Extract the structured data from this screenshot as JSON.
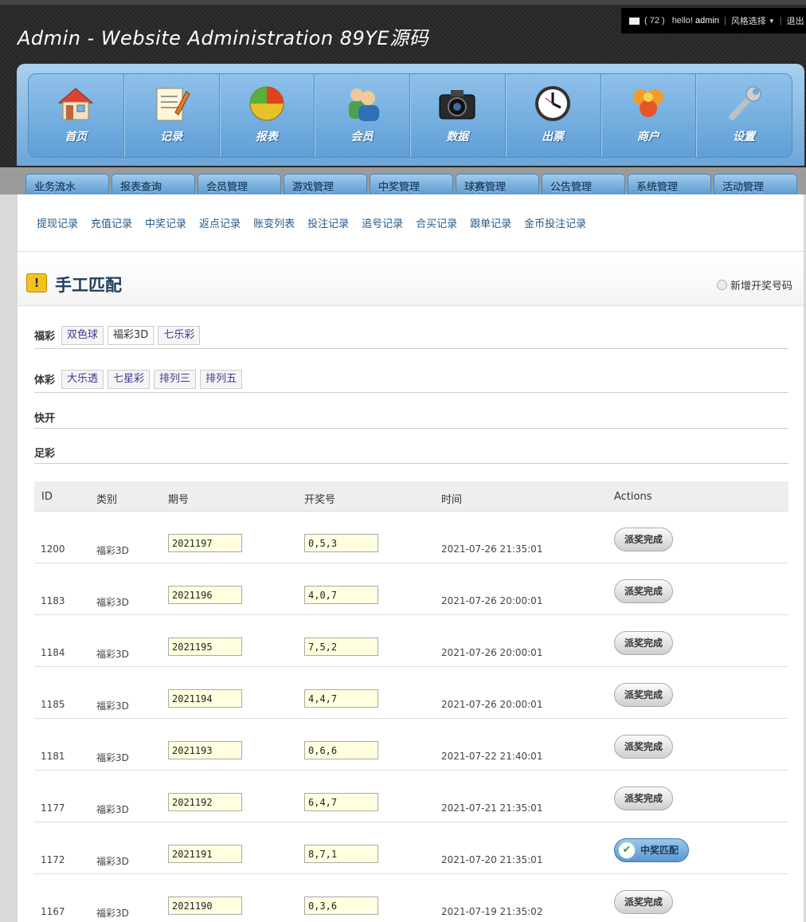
{
  "header": {
    "title": "Admin - Website Administration 89YE源码",
    "user": {
      "message_count": "( 72 )",
      "greeting": "hello!",
      "name": "admin",
      "style_select": "风格选择",
      "logout": "退出"
    }
  },
  "nav": [
    {
      "label": "首页",
      "icon": "home-icon"
    },
    {
      "label": "记录",
      "icon": "notepad-icon"
    },
    {
      "label": "报表",
      "icon": "pie-chart-icon"
    },
    {
      "label": "会员",
      "icon": "users-icon"
    },
    {
      "label": "数据",
      "icon": "camera-icon"
    },
    {
      "label": "出票",
      "icon": "clock-icon"
    },
    {
      "label": "商户",
      "icon": "merchant-icon"
    },
    {
      "label": "设置",
      "icon": "wrench-icon"
    }
  ],
  "tabs": [
    "业务流水",
    "报表查询",
    "会员管理",
    "游戏管理",
    "中奖管理",
    "球赛管理",
    "公告管理",
    "系统管理",
    "活动管理"
  ],
  "subnav": [
    "提现记录",
    "充值记录",
    "中奖记录",
    "返点记录",
    "账变列表",
    "投注记录",
    "追号记录",
    "合买记录",
    "跟单记录",
    "金币投注记录"
  ],
  "section": {
    "title": "手工匹配",
    "warn_glyph": "!",
    "add_label": "新增开奖号码"
  },
  "lottery_groups": [
    {
      "label": "福彩",
      "items": [
        "双色球",
        "福彩3D",
        "七乐彩"
      ],
      "active": "福彩3D"
    },
    {
      "label": "体彩",
      "items": [
        "大乐透",
        "七星彩",
        "排列三",
        "排列五"
      ],
      "active": ""
    },
    {
      "label": "快开",
      "items": [],
      "active": ""
    },
    {
      "label": "足彩",
      "items": [],
      "active": ""
    }
  ],
  "table": {
    "columns": [
      "ID",
      "类别",
      "期号",
      "开奖号",
      "时间",
      "Actions"
    ],
    "rows": [
      {
        "id": "1200",
        "category": "福彩3D",
        "issue": "2021197",
        "numbers": "0,5,3",
        "time": "2021-07-26 21:35:01",
        "action": "派奖完成",
        "action_type": "done"
      },
      {
        "id": "1183",
        "category": "福彩3D",
        "issue": "2021196",
        "numbers": "4,0,7",
        "time": "2021-07-26 20:00:01",
        "action": "派奖完成",
        "action_type": "done"
      },
      {
        "id": "1184",
        "category": "福彩3D",
        "issue": "2021195",
        "numbers": "7,5,2",
        "time": "2021-07-26 20:00:01",
        "action": "派奖完成",
        "action_type": "done"
      },
      {
        "id": "1185",
        "category": "福彩3D",
        "issue": "2021194",
        "numbers": "4,4,7",
        "time": "2021-07-26 20:00:01",
        "action": "派奖完成",
        "action_type": "done"
      },
      {
        "id": "1181",
        "category": "福彩3D",
        "issue": "2021193",
        "numbers": "0,6,6",
        "time": "2021-07-22 21:40:01",
        "action": "派奖完成",
        "action_type": "done"
      },
      {
        "id": "1177",
        "category": "福彩3D",
        "issue": "2021192",
        "numbers": "6,4,7",
        "time": "2021-07-21 21:35:01",
        "action": "派奖完成",
        "action_type": "done"
      },
      {
        "id": "1172",
        "category": "福彩3D",
        "issue": "2021191",
        "numbers": "8,7,1",
        "time": "2021-07-20 21:35:01",
        "action": "中奖匹配",
        "action_type": "match"
      },
      {
        "id": "1167",
        "category": "福彩3D",
        "issue": "2021190",
        "numbers": "0,3,6",
        "time": "2021-07-19 21:35:02",
        "action": "派奖完成",
        "action_type": "done"
      }
    ]
  }
}
